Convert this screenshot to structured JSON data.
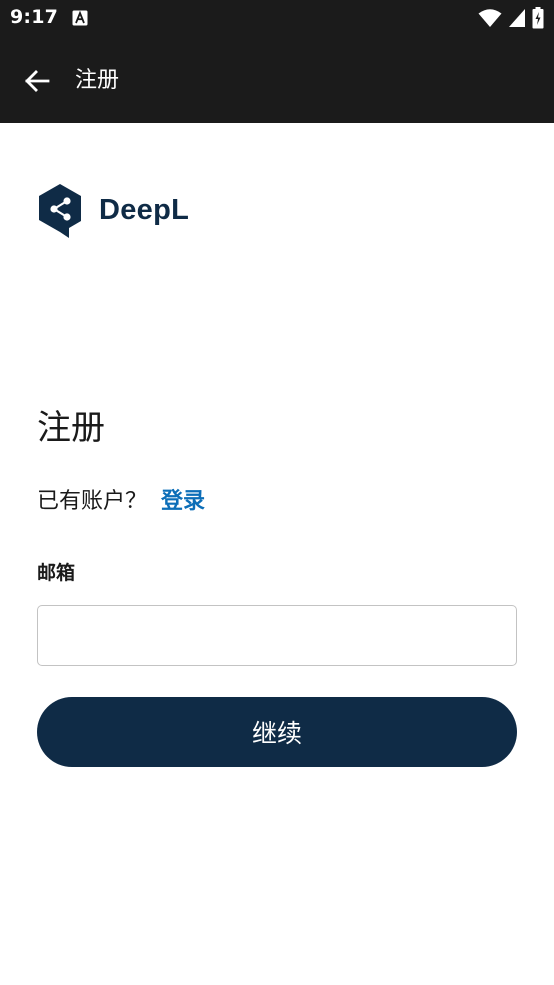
{
  "status_bar": {
    "time": "9:17",
    "icons": [
      "a-notification-icon",
      "wifi-icon",
      "cellular-signal-icon",
      "battery-charging-icon"
    ]
  },
  "app_bar": {
    "back_icon": "arrow-left-icon",
    "title": "注册"
  },
  "logo": {
    "brand_name": "DeepL",
    "icon": "deepl-logo-icon",
    "color": "#0f2b46"
  },
  "main": {
    "title": "注册",
    "signin_prompt": "已有账户？",
    "signin_link": "登录",
    "email_label": "邮箱",
    "email_value": "",
    "email_placeholder": "",
    "continue_label": "继续"
  },
  "colors": {
    "bar_background": "#1b1b1b",
    "primary": "#0f2b46",
    "link": "#0c6eb8",
    "text": "#1a1a1a",
    "border": "#c3c3c3"
  }
}
